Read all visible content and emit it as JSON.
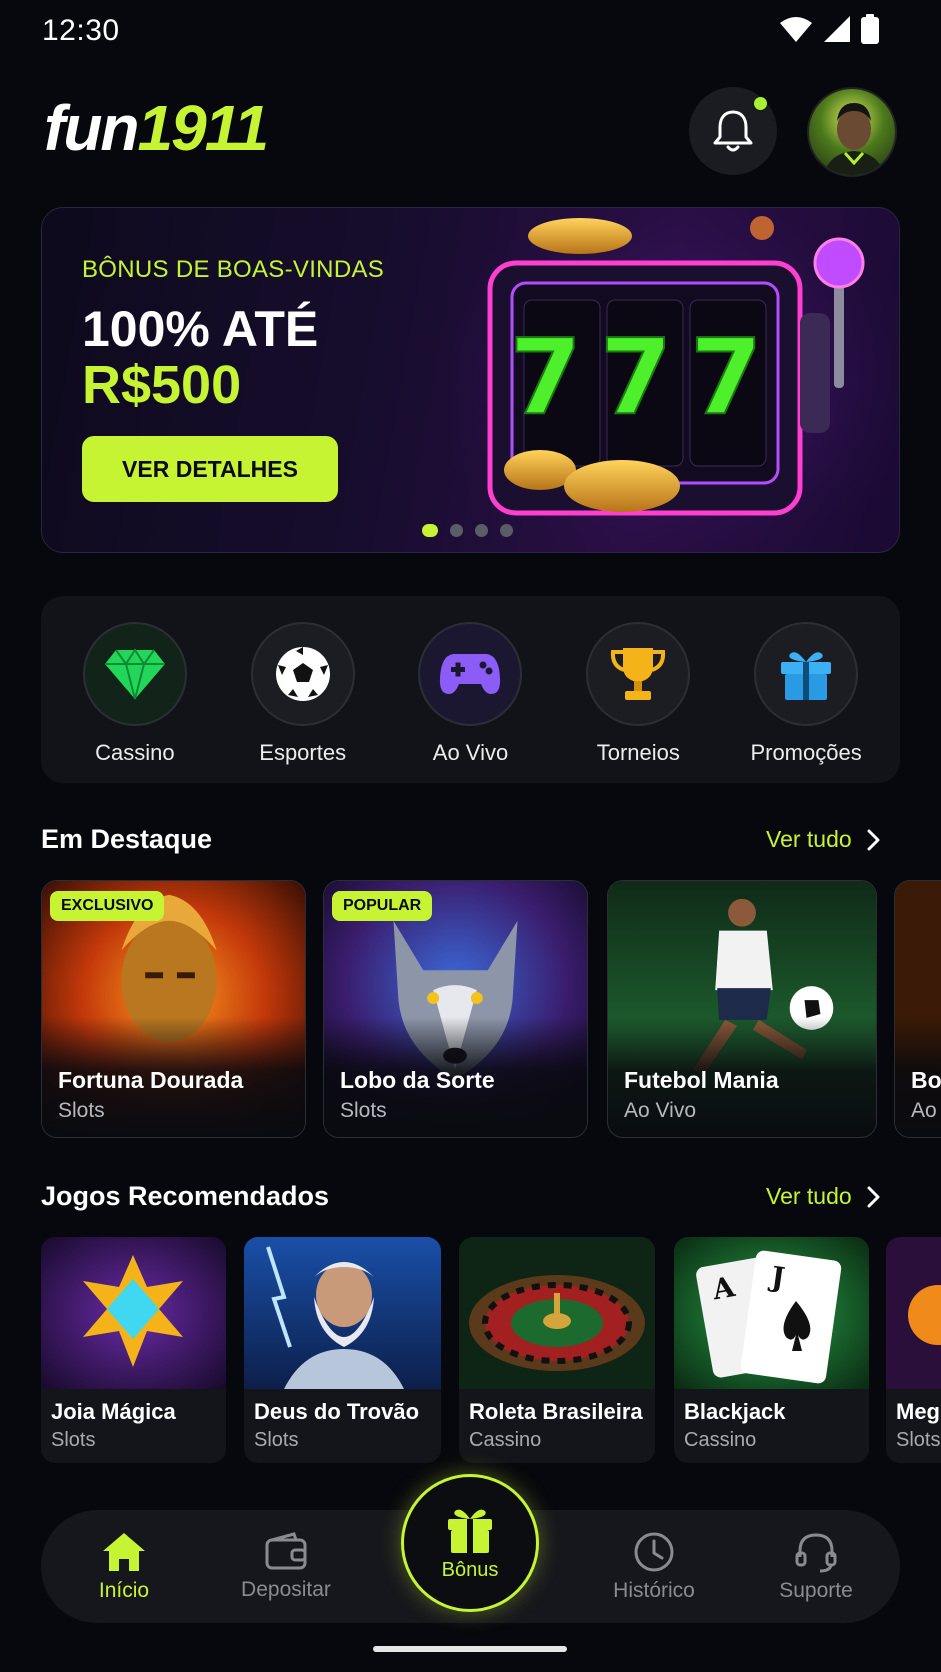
{
  "status_bar": {
    "time": "12:30"
  },
  "header": {
    "logo_part1": "fun",
    "logo_part2": "1911"
  },
  "banner": {
    "subtitle": "BÔNUS DE BOAS-VINDAS",
    "title_line1": "100% ATÉ",
    "title_line2": "R$500",
    "button_label": "VER DETALHES",
    "slot_digits": "777",
    "carousel_pages": 4,
    "carousel_active": 1
  },
  "categories": [
    {
      "label": "Cassino",
      "icon": "diamond-icon"
    },
    {
      "label": "Esportes",
      "icon": "soccer-ball-icon"
    },
    {
      "label": "Ao Vivo",
      "icon": "gamepad-icon"
    },
    {
      "label": "Torneios",
      "icon": "trophy-icon"
    },
    {
      "label": "Promoções",
      "icon": "gift-icon"
    }
  ],
  "featured": {
    "title": "Em Destaque",
    "see_all": "Ver tudo",
    "cards": [
      {
        "name": "Fortuna Dourada",
        "category": "Slots",
        "badge": "EXCLUSIVO"
      },
      {
        "name": "Lobo da Sorte",
        "category": "Slots",
        "badge": "POPULAR"
      },
      {
        "name": "Futebol Mania",
        "category": "Ao Vivo"
      },
      {
        "name": "Bo",
        "category": "Ao"
      }
    ]
  },
  "recommended": {
    "title": "Jogos Recomendados",
    "see_all": "Ver tudo",
    "cards": [
      {
        "name": "Joia Mágica",
        "category": "Slots"
      },
      {
        "name": "Deus do Trovão",
        "category": "Slots"
      },
      {
        "name": "Roleta Brasileira",
        "category": "Cassino"
      },
      {
        "name": "Blackjack",
        "category": "Cassino"
      },
      {
        "name": "Meg",
        "category": "Slots"
      }
    ]
  },
  "bottom_nav": {
    "items": [
      {
        "label": "Início",
        "icon": "home-icon",
        "active": true
      },
      {
        "label": "Depositar",
        "icon": "wallet-icon"
      },
      {
        "label": "Bônus",
        "icon": "gift-icon"
      },
      {
        "label": "Histórico",
        "icon": "clock-icon"
      },
      {
        "label": "Suporte",
        "icon": "headset-icon"
      }
    ]
  },
  "colors": {
    "accent": "#c6f432",
    "background": "#07080d",
    "card": "#121318"
  }
}
